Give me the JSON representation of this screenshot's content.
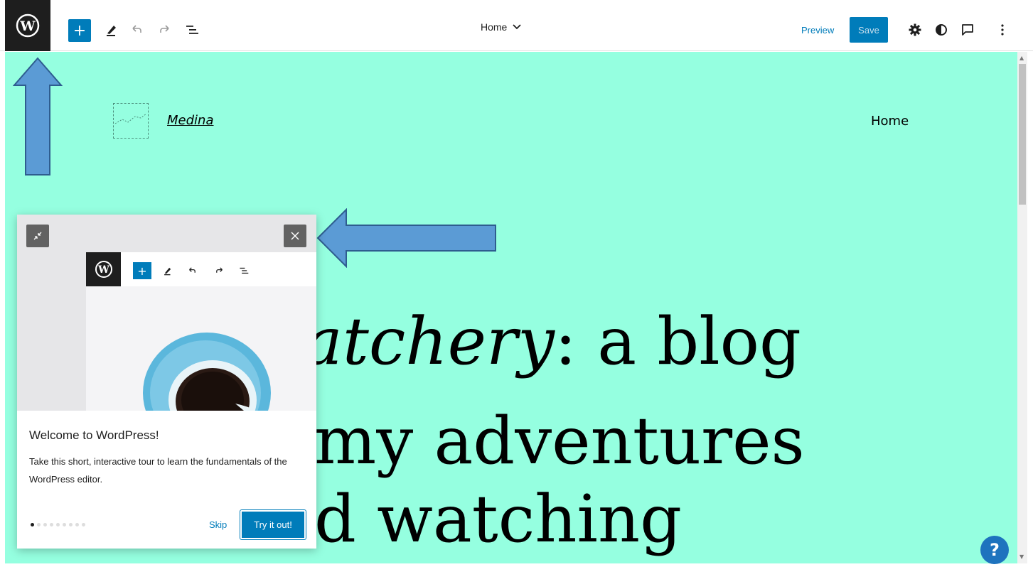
{
  "topbar": {
    "template_title": "Home",
    "preview_label": "Preview",
    "save_label": "Save",
    "icons": {
      "logo": "wordpress-logo-icon",
      "add": "plus-icon",
      "tools": "pencil-icon",
      "undo": "undo-icon",
      "redo": "redo-icon",
      "list_view": "list-view-icon",
      "settings": "gear-icon",
      "styles": "half-circle-icon",
      "comments": "comment-icon",
      "more": "vertical-dots-icon"
    }
  },
  "canvas": {
    "background_color": "#95ffe0",
    "site_title": "Medina",
    "nav_item": "Home",
    "hero": {
      "line1_italic": "atchery",
      "line1_rest": ": a blog",
      "line2": "my adventures",
      "line3": "d watching"
    }
  },
  "guide": {
    "heading": "Welcome to WordPress!",
    "text": "Take this short, interactive tour to learn the fundamentals of the WordPress editor.",
    "skip_label": "Skip",
    "try_label": "Try it out!",
    "page_count": 9,
    "current_page": 1
  },
  "help": {
    "label": "?"
  },
  "colors": {
    "accent": "#007cba",
    "dark": "#1e1e1e",
    "arrow_fill": "#5b9bd5",
    "arrow_stroke": "#2e5d8f"
  }
}
